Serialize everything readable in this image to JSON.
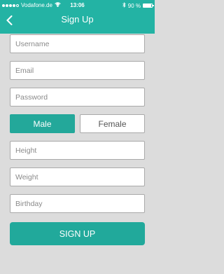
{
  "status_bar": {
    "carrier": "Vodafone.de",
    "time": "13:06",
    "battery_text": "90 %",
    "battery_level": 0.9,
    "signal_dots_filled": 4,
    "signal_dots_total": 5
  },
  "header": {
    "title": "Sign Up",
    "back_icon": "chevron-left-icon"
  },
  "form": {
    "username_placeholder": "Username",
    "email_placeholder": "Email",
    "password_placeholder": "Password",
    "gender": {
      "male_label": "Male",
      "female_label": "Female",
      "selected": "Male"
    },
    "height_placeholder": "Height",
    "weight_placeholder": "Weight",
    "birthday_placeholder": "Birthday",
    "submit_label": "SIGN UP"
  },
  "colors": {
    "accent": "#23b3a4",
    "selected_button": "#23a89a",
    "background": "#dcdcdc"
  }
}
